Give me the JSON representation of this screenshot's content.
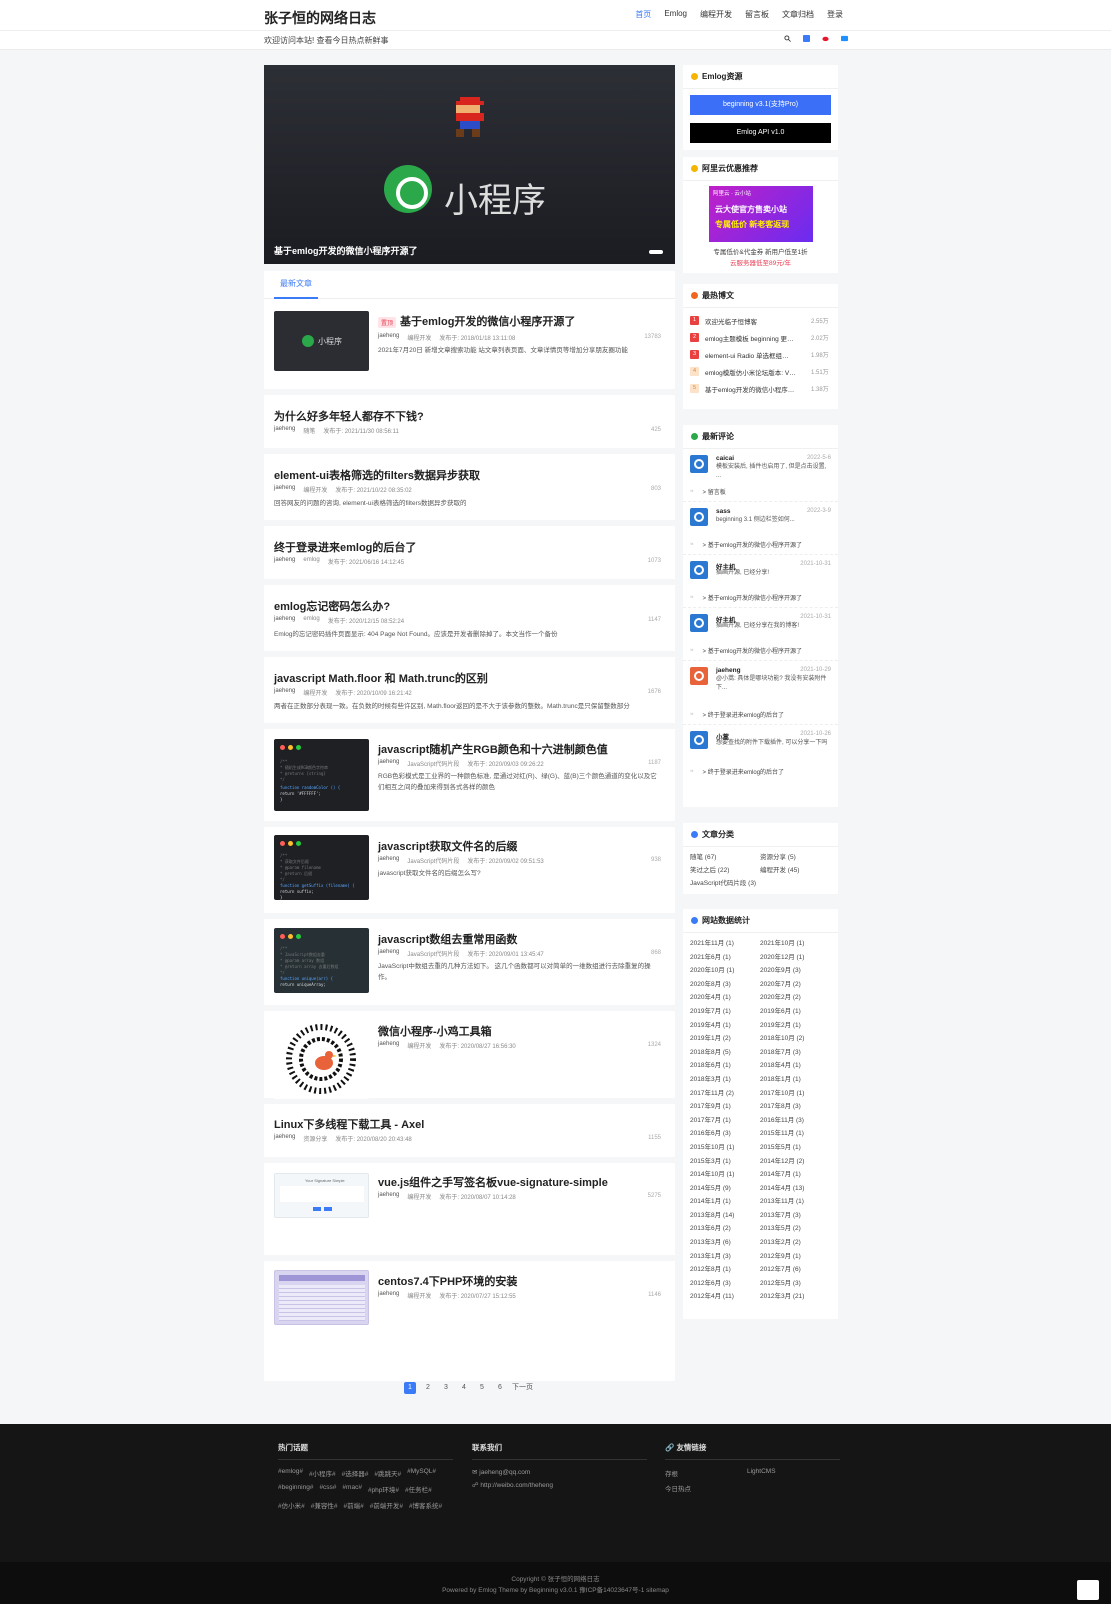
{
  "header": {
    "site_title": "张子恒的网络日志",
    "nav": [
      "首页",
      "Emlog",
      "编程开发",
      "留言板",
      "文章归档",
      "登录"
    ],
    "welcome": "欢迎访问本站! 查看今日热点新鲜事"
  },
  "slider": {
    "caption": "基于emlog开发的微信小程序开源了",
    "logo_text": "小程序"
  },
  "tab": "最新文章",
  "posts": [
    {
      "title": "基于emlog开发的微信小程序开源了",
      "badge": "置顶",
      "author": "jaeheng",
      "cat": "编程开发",
      "date": "发布于: 2018/01/18 13:11:08",
      "views": "13783",
      "desc": "2021年7月20日 新增文章搜索功能 站文章列表页面、文章详情页等增加分享朋友圈功能"
    },
    {
      "title": "为什么好多年轻人都存不下钱?",
      "author": "jaeheng",
      "cat": "随笔",
      "date": "发布于: 2021/11/30 08:56:11",
      "views": "425"
    },
    {
      "title": "element-ui表格筛选的filters数据异步获取",
      "author": "jaeheng",
      "cat": "编程开发",
      "date": "发布于: 2021/10/22 08:35:02",
      "views": "803",
      "desc": "回答网友的问题的咨询, element-ui表格筛选的filters数据异步获取的"
    },
    {
      "title": "终于登录进来emlog的后台了",
      "author": "jaeheng",
      "cat": "emlog",
      "date": "发布于: 2021/06/16 14:12:45",
      "views": "1073"
    },
    {
      "title": "emlog忘记密码怎么办?",
      "author": "jaeheng",
      "cat": "emlog",
      "date": "发布于: 2020/12/15 08:52:24",
      "views": "1147",
      "desc": "Emlog的忘记密码插件页面显示: 404 Page Not Found。应该是开发者删除掉了。本文当作一个备份"
    },
    {
      "title": "javascript Math.floor 和 Math.trunc的区别",
      "author": "jaeheng",
      "cat": "编程开发",
      "date": "发布于: 2020/10/09 16:21:42",
      "views": "1676",
      "desc": "两者在正数部分表现一致。在负数的时候有些许区别, Math.floor返回的是不大于该参数的整数。Math.trunc是只保留整数部分"
    },
    {
      "title": "javascript随机产生RGB颜色和十六进制颜色值",
      "author": "jaeheng",
      "cat": "JavaScript代码片段",
      "date": "发布于: 2020/09/03 09:26:22",
      "views": "1187",
      "desc": "RGB色彩模式是工业界的一种颜色标准, 是通过对红(R)、绿(G)、蓝(B)三个颜色通道的变化以及它们相互之间的叠加来得到各式各样的颜色"
    },
    {
      "title": "javascript获取文件名的后缀",
      "author": "jaeheng",
      "cat": "JavaScript代码片段",
      "date": "发布于: 2020/09/02 09:51:53",
      "views": "938",
      "desc": "javascript获取文件名的后缀怎么写?"
    },
    {
      "title": "javascript数组去重常用函数",
      "author": "jaeheng",
      "cat": "JavaScript代码片段",
      "date": "发布于: 2020/09/01 13:45:47",
      "views": "868",
      "desc": "JavaScript中数组去重的几种方法如下。 这几个函数都可以对简单的一维数组进行去除重复的操作。"
    },
    {
      "title": "微信小程序-小鸡工具箱",
      "author": "jaeheng",
      "cat": "编程开发",
      "date": "发布于: 2020/08/27 16:56:30",
      "views": "1324"
    },
    {
      "title": "Linux下多线程下载工具 - Axel",
      "author": "jaeheng",
      "cat": "资源分享",
      "date": "发布于: 2020/08/20 20:43:48",
      "views": "1155"
    },
    {
      "title": "vue.js组件之手写签名板vue-signature-simple",
      "author": "jaeheng",
      "cat": "编程开发",
      "date": "发布于: 2020/08/07 10:14:28",
      "views": "5275"
    },
    {
      "title": "centos7.4下PHP环境的安装",
      "author": "jaeheng",
      "cat": "编程开发",
      "date": "发布于: 2020/07/27 15:12:55",
      "views": "1146"
    }
  ],
  "code_snippets": {
    "s1": [
      "/**",
      " * 随机生成RGB颜色字符串",
      " * @returns {string}",
      " */",
      "function randomColor () {",
      "  return '#FFFFFF';",
      "}"
    ],
    "s2": [
      "/**",
      " * 获取文件后缀",
      " * @param filename",
      " * @return 后缀",
      " */",
      "function getSuffix (filename) {",
      "  return suffix;",
      "}"
    ],
    "s3": [
      "/**",
      " * JavaScript数组去重",
      " * @param array 数组",
      " * @return array 去重后数组",
      " */",
      "function unique(arr) {",
      "  return uniqueArray;",
      "}"
    ],
    "sig": "Your Signature Simple"
  },
  "pager": {
    "pages": [
      "1",
      "2",
      "3",
      "4",
      "5",
      "6"
    ],
    "next": "下一页"
  },
  "side": {
    "res_title": "Emlog资源",
    "btn1": "beginning v3.1(支持Pro)",
    "btn2": "Emlog API v1.0",
    "ad_title": "阿里云优惠推荐",
    "ad_top": "阿里云 · 云小站",
    "ad_line1": "云大使官方售卖小站",
    "ad_line2": "专属低价 新老客返现",
    "ad_text1": "专属低价&代金券 新用户低至1折",
    "ad_text2": "云服务器低至89元/年",
    "hot_title": "最热博文",
    "hot": [
      {
        "n": "1",
        "t": "欢迎光临子恒博客",
        "c": "2.55万"
      },
      {
        "n": "2",
        "t": "emlog主题模板 beginning 更…",
        "c": "2.02万"
      },
      {
        "n": "3",
        "t": "element-ui Radio 单选框组…",
        "c": "1.98万"
      },
      {
        "n": "4",
        "t": "emlog模版仿小米论坛版本: V…",
        "c": "1.51万"
      },
      {
        "n": "5",
        "t": "基于emlog开发的微信小程序…",
        "c": "1.38万"
      }
    ],
    "cm_title": "最新评论",
    "comments": [
      {
        "nm": "caicai",
        "dt": "2022-5-6",
        "tx": "模板安装后, 插件也启用了, 但是点击设置, ...",
        "to": "留言板"
      },
      {
        "nm": "sass",
        "dt": "2022-3-9",
        "tx": "beginning 3.1 侧边栏签如何...",
        "to": "基于emlog开发的微信小程序开源了"
      },
      {
        "nm": "好主机",
        "dt": "2021-10-31",
        "tx": "插画开源, 已经分享!",
        "to": "基于emlog开发的微信小程序开源了"
      },
      {
        "nm": "好主机",
        "dt": "2021-10-31",
        "tx": "插画开源, 已经分享在我的博客!",
        "to": "基于emlog开发的微信小程序开源了"
      },
      {
        "nm": "jaeheng",
        "dt": "2021-10-29",
        "tx": "@小蒿: 具体是哪块功能? 我没有安装附件下...",
        "to": "终于登录进来emlog的后台了"
      },
      {
        "nm": "小蒿",
        "dt": "2021-10-26",
        "tx": "想要查找的附件下载插件, 可以分享一下吗",
        "to": "终于登录进来emlog的后台了"
      }
    ],
    "cat_title": "文章分类",
    "cats": [
      "随笔 (67)",
      "资源分享 (5)",
      "笑过之后 (22)",
      "编程开发 (45)",
      "JavaScript代码片段 (3)",
      "emlog (15)"
    ],
    "stat_title": "网站数据统计",
    "stats": [
      "2021年11月 (1)",
      "2021年10月 (1)",
      "2021年6月 (1)",
      "2020年12月 (1)",
      "2020年10月 (1)",
      "2020年9月 (3)",
      "2020年8月 (3)",
      "2020年7月 (2)",
      "2020年4月 (1)",
      "2020年2月 (2)",
      "2019年7月 (1)",
      "2019年6月 (1)",
      "2019年4月 (1)",
      "2019年2月 (1)",
      "2019年1月 (2)",
      "2018年10月 (2)",
      "2018年8月 (5)",
      "2018年7月 (3)",
      "2018年6月 (1)",
      "2018年4月 (1)",
      "2018年3月 (1)",
      "2018年1月 (1)",
      "2017年11月 (2)",
      "2017年10月 (1)",
      "2017年9月 (1)",
      "2017年8月 (3)",
      "2017年7月 (1)",
      "2016年11月 (3)",
      "2016年6月 (3)",
      "2015年11月 (1)",
      "2015年10月 (1)",
      "2015年5月 (1)",
      "2015年3月 (1)",
      "2014年12月 (2)",
      "2014年10月 (1)",
      "2014年7月 (1)",
      "2014年5月 (9)",
      "2014年4月 (13)",
      "2014年1月 (1)",
      "2013年11月 (1)",
      "2013年8月 (14)",
      "2013年7月 (3)",
      "2013年6月 (2)",
      "2013年5月 (2)",
      "2013年3月 (6)",
      "2013年2月 (2)",
      "2013年1月 (3)",
      "2012年9月 (1)",
      "2012年8月 (1)",
      "2012年7月 (6)",
      "2012年6月 (3)",
      "2012年5月 (3)",
      "2012年4月 (11)",
      "2012年3月 (21)"
    ]
  },
  "footer": {
    "hot_title": "热门话题",
    "tags": [
      "#emlog#",
      "#小程序#",
      "#选择器#",
      "#跳跳天#",
      "#MySQL#",
      "#beginning#",
      "#css#",
      "#mac#",
      "#php环境#",
      "#任务栏#",
      "#仿小米#",
      "#兼容性#",
      "#前端#",
      "#前端开发#",
      "#博客系统#"
    ],
    "contact_title": "联系我们",
    "email": "jaeheng@qq.com",
    "weibo": "http://weibo.com/theheng",
    "links_title": "友情链接",
    "links": [
      "存根",
      "LightCMS",
      "今日热点"
    ],
    "copy1": "Copyright © 张子恒的网络日志",
    "copy2": "Powered by Emlog  Theme by Beginning v3.0.1  豫ICP备14023647号-1 sitemap"
  },
  "colors": {
    "accent": "#3c7bf7",
    "footer": "#151515"
  }
}
